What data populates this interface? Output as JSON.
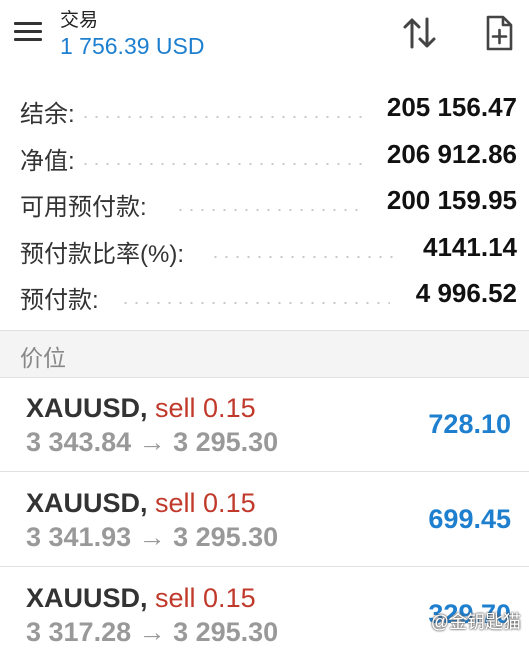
{
  "header": {
    "title": "交易",
    "balance_display": "1 756.39 USD",
    "icons": {
      "menu": "hamburger-menu-icon",
      "sort": "sort-arrows-icon",
      "new_order": "new-document-icon"
    }
  },
  "account": {
    "rows": [
      {
        "label": "结余:",
        "value": "205 156.47"
      },
      {
        "label": "净值:",
        "value": "206 912.86"
      },
      {
        "label": "可用预付款:",
        "value": "200 159.95"
      },
      {
        "label": "预付款比率(%):",
        "value": "4141.14"
      },
      {
        "label": "预付款:",
        "value": "4 996.52"
      }
    ]
  },
  "positions_section": {
    "title": "价位"
  },
  "positions": [
    {
      "symbol": "XAUUSD,",
      "side": "sell 0.15",
      "prices": "3 343.84 → 3 295.30",
      "profit": "728.10"
    },
    {
      "symbol": "XAUUSD,",
      "side": "sell 0.15",
      "prices": "3 341.93 → 3 295.30",
      "profit": "699.45"
    },
    {
      "symbol": "XAUUSD,",
      "side": "sell 0.15",
      "prices": "3 317.28 → 3 295.30",
      "profit": "329.70"
    }
  ],
  "watermark": "@金钥匙猫",
  "colors": {
    "accent": "#1e7fcf",
    "sell": "#c0392b",
    "muted": "#999999"
  }
}
